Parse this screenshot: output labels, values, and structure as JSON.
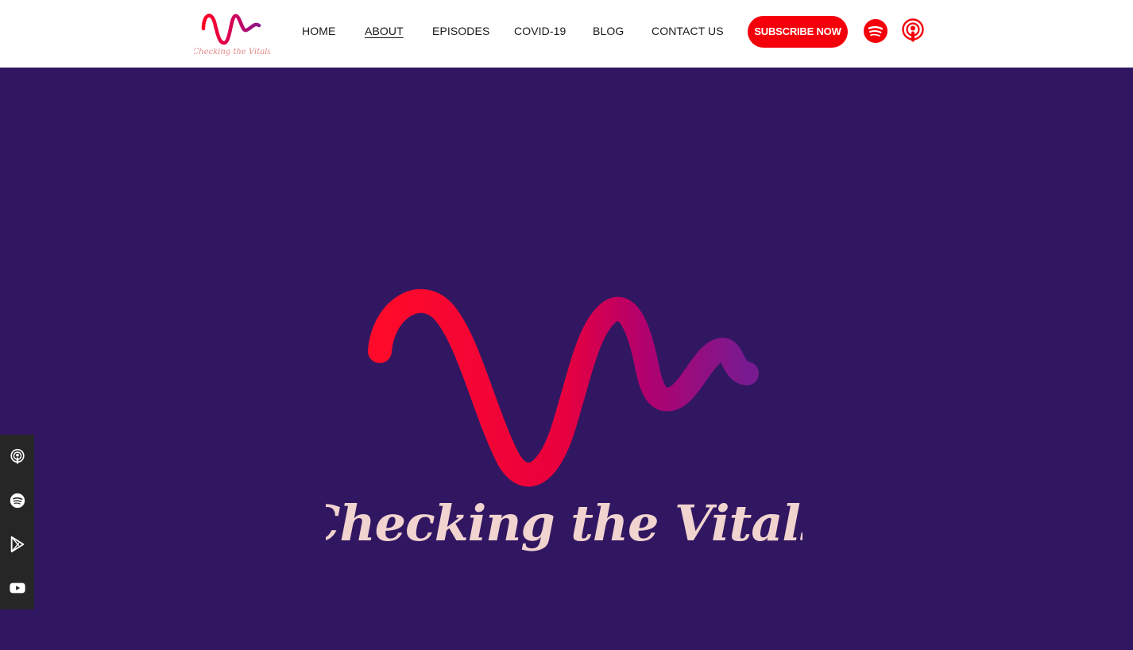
{
  "header": {
    "logo_text": "Checking the Vitals",
    "nav": [
      {
        "label": "HOME",
        "active": false
      },
      {
        "label": "ABOUT",
        "active": true
      },
      {
        "label": "EPISODES",
        "active": false
      },
      {
        "label": "COVID-19",
        "active": false
      },
      {
        "label": "BLOG",
        "active": false
      },
      {
        "label": "CONTACT US",
        "active": false
      }
    ],
    "subscribe_label": "SUBSCRIBE NOW",
    "icons": [
      "spotify-icon",
      "apple-podcasts-icon"
    ]
  },
  "hero": {
    "logo_text": "Checking the Vitals"
  },
  "sidebar": {
    "icons": [
      "apple-podcasts-icon",
      "spotify-icon",
      "google-play-icon",
      "youtube-icon"
    ]
  },
  "colors": {
    "accent": "#f5000a",
    "hero_bg": "#311762",
    "logo_text": "#f1d3cf",
    "sidebar_bg": "#262626"
  }
}
